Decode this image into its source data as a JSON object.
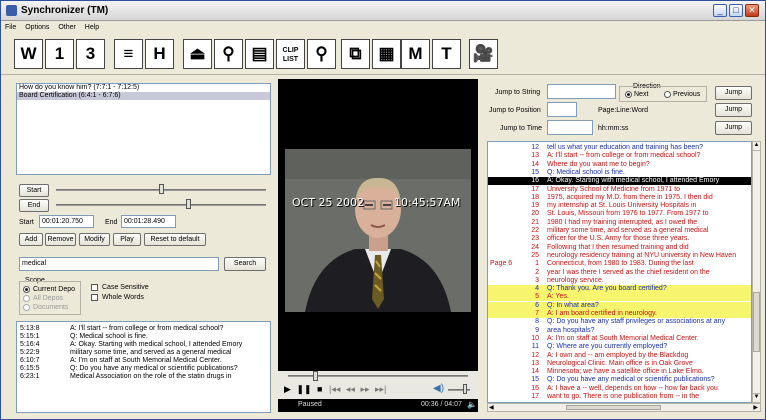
{
  "window": {
    "title": "Synchronizer (TM)",
    "min": "_",
    "max": "□",
    "close": "✕"
  },
  "menu": [
    "File",
    "Options",
    "Other",
    "Help"
  ],
  "toolbar": [
    {
      "name": "w-button",
      "label": "W"
    },
    {
      "name": "one-button",
      "label": "1"
    },
    {
      "name": "three-button",
      "label": "3"
    },
    {
      "name": "format-button",
      "label": "≡"
    },
    {
      "name": "h-button",
      "label": "H"
    },
    {
      "name": "tray-button",
      "label": "⏏"
    },
    {
      "name": "search-button",
      "label": "⚲"
    },
    {
      "name": "document-button",
      "label": "▤"
    },
    {
      "name": "clip-list-button",
      "label": "CLIP LIST"
    },
    {
      "name": "find-button",
      "label": "⚲"
    },
    {
      "name": "copy-button",
      "label": "⧉"
    },
    {
      "name": "layout-button",
      "label": "▦"
    },
    {
      "name": "m-button",
      "label": "M"
    },
    {
      "name": "t-button",
      "label": "T"
    },
    {
      "name": "camera-button",
      "label": "🎥"
    }
  ],
  "clips": {
    "items": [
      "How do you know him? (7:7:1 - 7:12:5)",
      "Board Certification (6:4:1 - 6:7:6)"
    ],
    "selected_index": 1
  },
  "clip_controls": {
    "start_label": "Start",
    "end_label": "End",
    "start_slider_fraction": 0.5,
    "end_slider_fraction": 0.63,
    "start_time_label": "Start",
    "start_time_value": "00:01:20.750",
    "end_time_label": "End",
    "end_time_value": "00:01:28.490",
    "add": "Add",
    "remove": "Remove",
    "modify": "Modify",
    "play": "Play",
    "reset": "Reset to default"
  },
  "search": {
    "value": "medical",
    "button": "Search",
    "scope_label": "Scope",
    "scope_options": [
      "Current Depo",
      "All Depos",
      "Documents"
    ],
    "case_sensitive": "Case Sensitive",
    "whole_words": "Whole Words"
  },
  "results": [
    {
      "ref": "5:13:8",
      "text": "A: I'll start -- from college or from medical school?"
    },
    {
      "ref": "5:15:1",
      "text": "Q: Medical school is fine."
    },
    {
      "ref": "5:16:4",
      "text": "A: Okay. Starting with medical school, I attended Emory"
    },
    {
      "ref": "5:22:9",
      "text": "military some time, and served as a general medical"
    },
    {
      "ref": "6:10:7",
      "text": "A: I'm on staff at South Memorial Medical Center."
    },
    {
      "ref": "6:15:5",
      "text": "Q: Do you have any medical or scientific publications?"
    },
    {
      "ref": "6:23:1",
      "text": "Medical Association on the role of the statin drugs in"
    }
  ],
  "video": {
    "date_overlay": "OCT 25 2002",
    "time_overlay": "10:45:57AM",
    "status": "Paused",
    "position": "00:36 / 04:07",
    "seek_fraction": 0.15,
    "volume_fraction": 0.75
  },
  "jump": {
    "string_label": "Jump to String",
    "position_label": "Jump to Position",
    "position_hint": "Page:Line:Word",
    "time_label": "Jump to Time",
    "time_hint": "hh:mm:ss",
    "direction_label": "Direction",
    "next": "Next",
    "previous": "Previous",
    "jump_button": "Jump"
  },
  "colors": {
    "red_text": "#cc1111",
    "blue_text": "#1a2fb0",
    "highlight_yellow": "#f7f46e",
    "current_line_bg": "#000000"
  },
  "transcript": [
    {
      "page": "",
      "line": "12",
      "text": "tell us what your education and training has been?",
      "color": "blue",
      "hl": ""
    },
    {
      "page": "",
      "line": "13",
      "text": "A:  I'll start -- from college or from medical school?",
      "color": "red",
      "hl": ""
    },
    {
      "page": "",
      "line": "14",
      "text": "Where do you want me to begin?",
      "color": "red",
      "hl": ""
    },
    {
      "page": "",
      "line": "15",
      "text": "Q:  Medical school is fine.",
      "color": "blue",
      "hl": ""
    },
    {
      "page": "",
      "line": "16",
      "text": "A:  Okay. Starting with medical school, I attended Emory",
      "color": "white",
      "hl": "current"
    },
    {
      "page": "",
      "line": "17",
      "text": "University School of Medicine from 1971 to",
      "color": "red",
      "hl": ""
    },
    {
      "page": "",
      "line": "18",
      "text": "1975, acquired my M.D. from there in 1975. I then did",
      "color": "red",
      "hl": ""
    },
    {
      "page": "",
      "line": "19",
      "text": "my internship at St. Louis University Hospitals in",
      "color": "red",
      "hl": ""
    },
    {
      "page": "",
      "line": "20",
      "text": "St. Louis, Missouri from 1976 to 1977. From 1977 to",
      "color": "red",
      "hl": ""
    },
    {
      "page": "",
      "line": "21",
      "text": "1980 I had my training interrupted, as I owed the",
      "color": "red",
      "hl": ""
    },
    {
      "page": "",
      "line": "22",
      "text": "military some time, and served as a general medical",
      "color": "red",
      "hl": ""
    },
    {
      "page": "",
      "line": "23",
      "text": "officer for the U.S. Army for those three years.",
      "color": "red",
      "hl": ""
    },
    {
      "page": "",
      "line": "24",
      "text": "Following that I then resumed training and did",
      "color": "red",
      "hl": ""
    },
    {
      "page": "",
      "line": "25",
      "text": "neurology residency training at NYU university in New Haven",
      "color": "red",
      "hl": ""
    },
    {
      "page": "Page 6",
      "line": "1",
      "text": "Connecticut, from 1980 to 1983. During the last",
      "color": "red",
      "hl": ""
    },
    {
      "page": "",
      "line": "2",
      "text": "year I was there I served as the chief resident on the",
      "color": "red",
      "hl": ""
    },
    {
      "page": "",
      "line": "3",
      "text": "neurology service.",
      "color": "red",
      "hl": ""
    },
    {
      "page": "",
      "line": "4",
      "text": "Q:  Thank you. Are you board certified?",
      "color": "blue",
      "hl": "yellow"
    },
    {
      "page": "",
      "line": "5",
      "text": "A:  Yes.",
      "color": "red",
      "hl": "yellow"
    },
    {
      "page": "",
      "line": "6",
      "text": "Q:  In what area?",
      "color": "blue",
      "hl": "yellow"
    },
    {
      "page": "",
      "line": "7",
      "text": "A:  I am board certified in neurology.",
      "color": "red",
      "hl": "yellow"
    },
    {
      "page": "",
      "line": "8",
      "text": "Q:  Do you have any staff privileges or associations at any",
      "color": "blue",
      "hl": ""
    },
    {
      "page": "",
      "line": "9",
      "text": "area hospitals?",
      "color": "blue",
      "hl": ""
    },
    {
      "page": "",
      "line": "10",
      "text": "A:  I'm on staff at South Memorial Medical Center.",
      "color": "red",
      "hl": ""
    },
    {
      "page": "",
      "line": "11",
      "text": "Q:  Where are you currently employed?",
      "color": "blue",
      "hl": ""
    },
    {
      "page": "",
      "line": "12",
      "text": "A:  I own and -- am employed by the Blackdog",
      "color": "red",
      "hl": ""
    },
    {
      "page": "",
      "line": "13",
      "text": "Neurological Clinic. Main office is in Oak Grove",
      "color": "red",
      "hl": ""
    },
    {
      "page": "",
      "line": "14",
      "text": "Minnesota; we have a satellite office in Lake Elmo.",
      "color": "red",
      "hl": ""
    },
    {
      "page": "",
      "line": "15",
      "text": "Q:  Do you have any medical or scientific publications?",
      "color": "blue",
      "hl": ""
    },
    {
      "page": "",
      "line": "16",
      "text": "A:  I have a -- well, depends on how -- how far back you",
      "color": "red",
      "hl": ""
    },
    {
      "page": "",
      "line": "17",
      "text": "want to go. There is one publication from -- in the",
      "color": "red",
      "hl": ""
    }
  ]
}
